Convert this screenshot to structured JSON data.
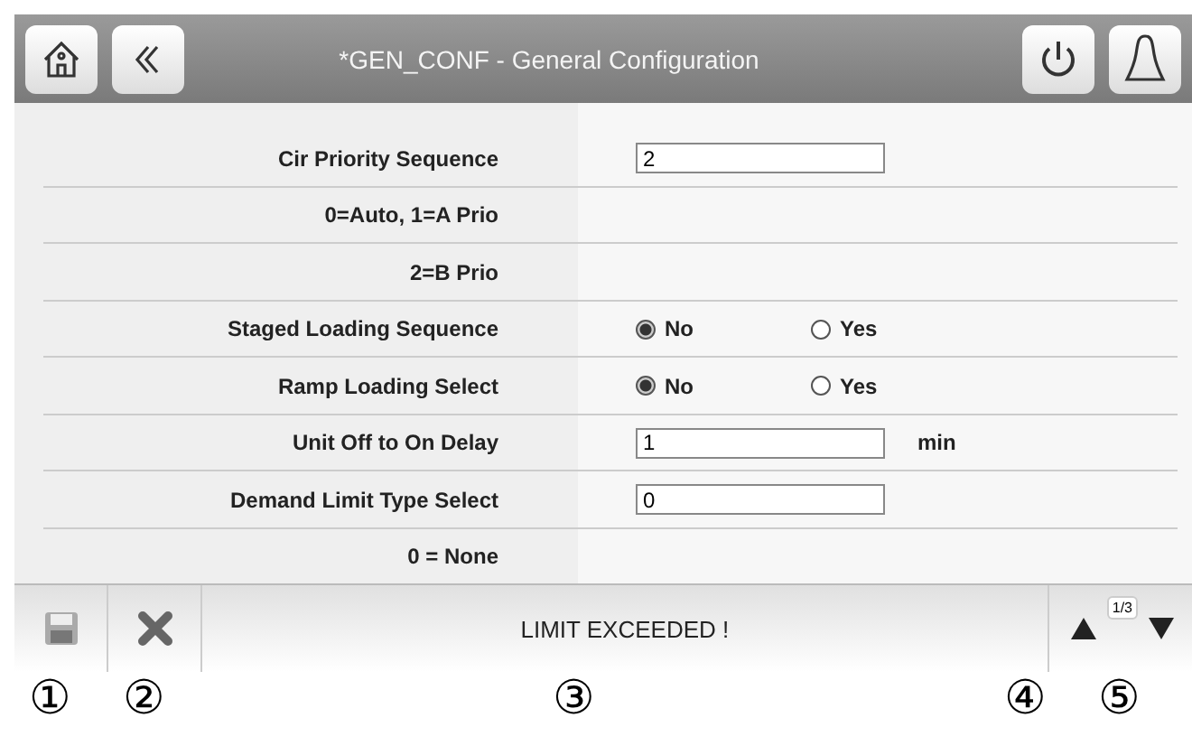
{
  "header": {
    "title": "*GEN_CONF - General Configuration"
  },
  "rows": [
    {
      "kind": "field",
      "label": "Cir Priority Sequence",
      "value": "2"
    },
    {
      "kind": "note",
      "label": "0=Auto,   1=A Prio"
    },
    {
      "kind": "note",
      "label": "2=B Prio"
    },
    {
      "kind": "radio",
      "label": "Staged Loading Sequence",
      "options": [
        {
          "label": "No",
          "selected": true
        },
        {
          "label": "Yes",
          "selected": false
        }
      ]
    },
    {
      "kind": "radio",
      "label": "Ramp Loading Select",
      "options": [
        {
          "label": "No",
          "selected": true
        },
        {
          "label": "Yes",
          "selected": false
        }
      ]
    },
    {
      "kind": "field",
      "label": "Unit Off to On Delay",
      "value": "1",
      "unit": "min"
    },
    {
      "kind": "field",
      "label": "Demand Limit Type Select",
      "value": "0"
    },
    {
      "kind": "note",
      "label": "0 = None"
    }
  ],
  "status_bar": {
    "message": "LIMIT EXCEEDED !",
    "page": "1/3"
  },
  "callouts": [
    "①",
    "②",
    "③",
    "④",
    "⑤"
  ]
}
